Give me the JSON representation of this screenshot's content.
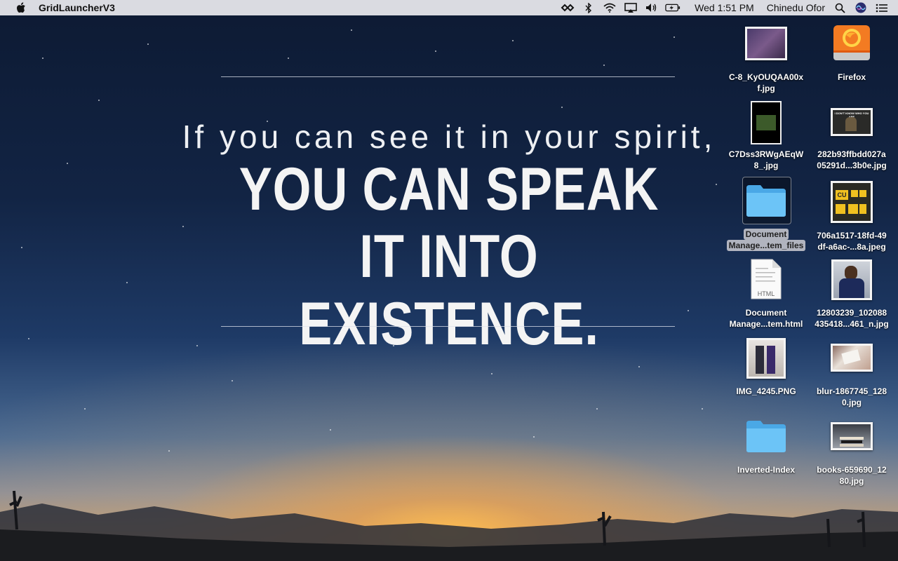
{
  "menubar": {
    "app_name": "GridLauncherV3",
    "clock": "Wed 1:51 PM",
    "user": "Chinedu Ofor",
    "status_icons": [
      "vpn-icon",
      "bluetooth-icon",
      "wifi-icon",
      "airplay-icon",
      "volume-icon",
      "battery-icon",
      "spotlight-icon",
      "siri-icon",
      "notification-center-icon"
    ]
  },
  "wallpaper": {
    "line1": "If you can see it in your spirit,",
    "line2": "YOU CAN SPEAK IT INTO",
    "line3": "EXISTENCE."
  },
  "desktop_icons": [
    {
      "l1": "C-8_KyOUQAA00x",
      "l2": "f.jpg"
    },
    {
      "l1": "Firefox",
      "l2": ""
    },
    {
      "l1": "C7Dss3RWgAEqW",
      "l2": "8_.jpg"
    },
    {
      "l1": "282b93ffbdd027a",
      "l2": "05291d...3b0e.jpg"
    },
    {
      "l1": "Document",
      "l2": "Manage...tem_files"
    },
    {
      "l1": "706a1517-18fd-49",
      "l2": "df-a6ac-...8a.jpeg"
    },
    {
      "l1": "Document",
      "l2": "Manage...tem.html"
    },
    {
      "l1": "12803239_102088",
      "l2": "435418...461_n.jpg"
    },
    {
      "l1": "IMG_4245.PNG",
      "l2": ""
    },
    {
      "l1": "blur-1867745_128",
      "l2": "0.jpg"
    },
    {
      "l1": "Inverted-Index",
      "l2": ""
    },
    {
      "l1": "books-659690_12",
      "l2": "80.jpg"
    }
  ],
  "html_badge": "HTML",
  "thumb_text": {
    "cu": "CU",
    "meme": "I DON'T KNOW WHO YOU ARE"
  },
  "colors": {
    "folder": "#5bbcf5",
    "accent_sunset": "#f5b04c"
  }
}
